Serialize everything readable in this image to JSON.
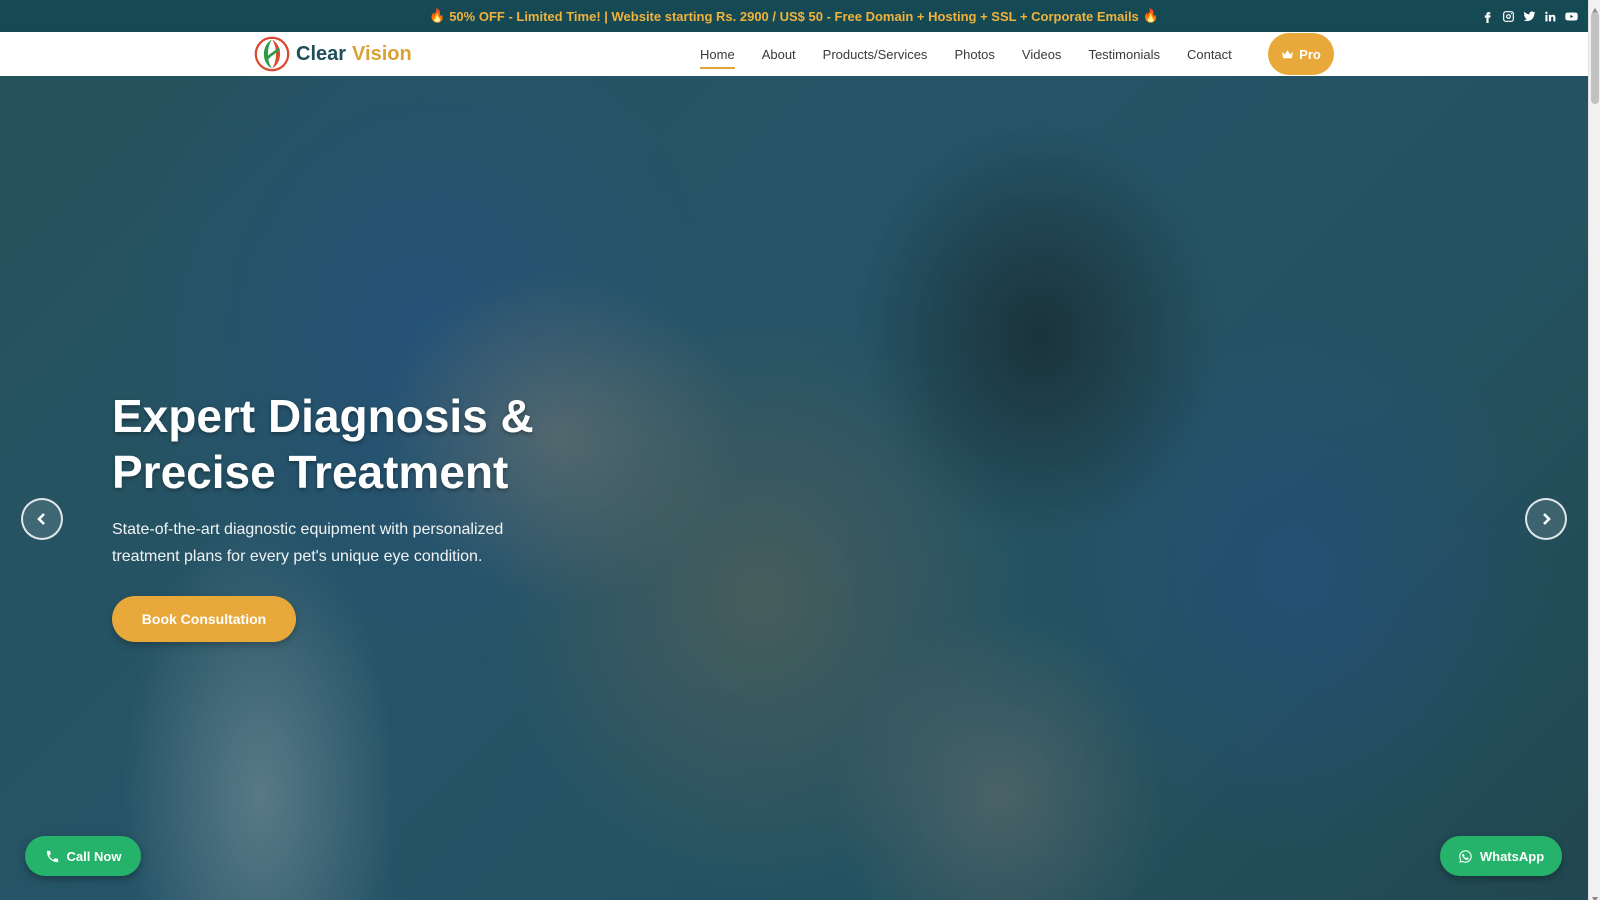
{
  "announcement": {
    "text": "50% OFF - Limited Time! | Website starting Rs. 2900 / US$ 50 - Free Domain + Hosting + SSL + Corporate Emails",
    "icon_left": "fire-icon",
    "icon_right": "fire-icon",
    "emoji": "🔥"
  },
  "socials": [
    "facebook-icon",
    "instagram-icon",
    "twitter-icon",
    "linkedin-icon",
    "youtube-icon"
  ],
  "brand": {
    "name_part1": "Clear",
    "name_part2": "Vision",
    "primary_color": "#1f4e59",
    "accent_color": "#d9a235"
  },
  "nav": {
    "items": [
      {
        "label": "Home",
        "active": true
      },
      {
        "label": "About",
        "active": false
      },
      {
        "label": "Products/Services",
        "active": false
      },
      {
        "label": "Photos",
        "active": false
      },
      {
        "label": "Videos",
        "active": false
      },
      {
        "label": "Testimonials",
        "active": false
      },
      {
        "label": "Contact",
        "active": false
      }
    ],
    "pro_label": "Pro",
    "pro_icon": "crown-icon"
  },
  "hero": {
    "title_line1": "Expert Diagnosis &",
    "title_line2": "Precise Treatment",
    "subtitle": "State-of-the-art diagnostic equipment with personalized treatment plans for every pet's unique eye condition.",
    "cta_label": "Book Consultation",
    "prev_icon": "chevron-left-icon",
    "next_icon": "chevron-right-icon"
  },
  "floating": {
    "call_label": "Call Now",
    "call_icon": "phone-icon",
    "whatsapp_label": "WhatsApp",
    "whatsapp_icon": "whatsapp-icon",
    "color": "#25b36b"
  }
}
